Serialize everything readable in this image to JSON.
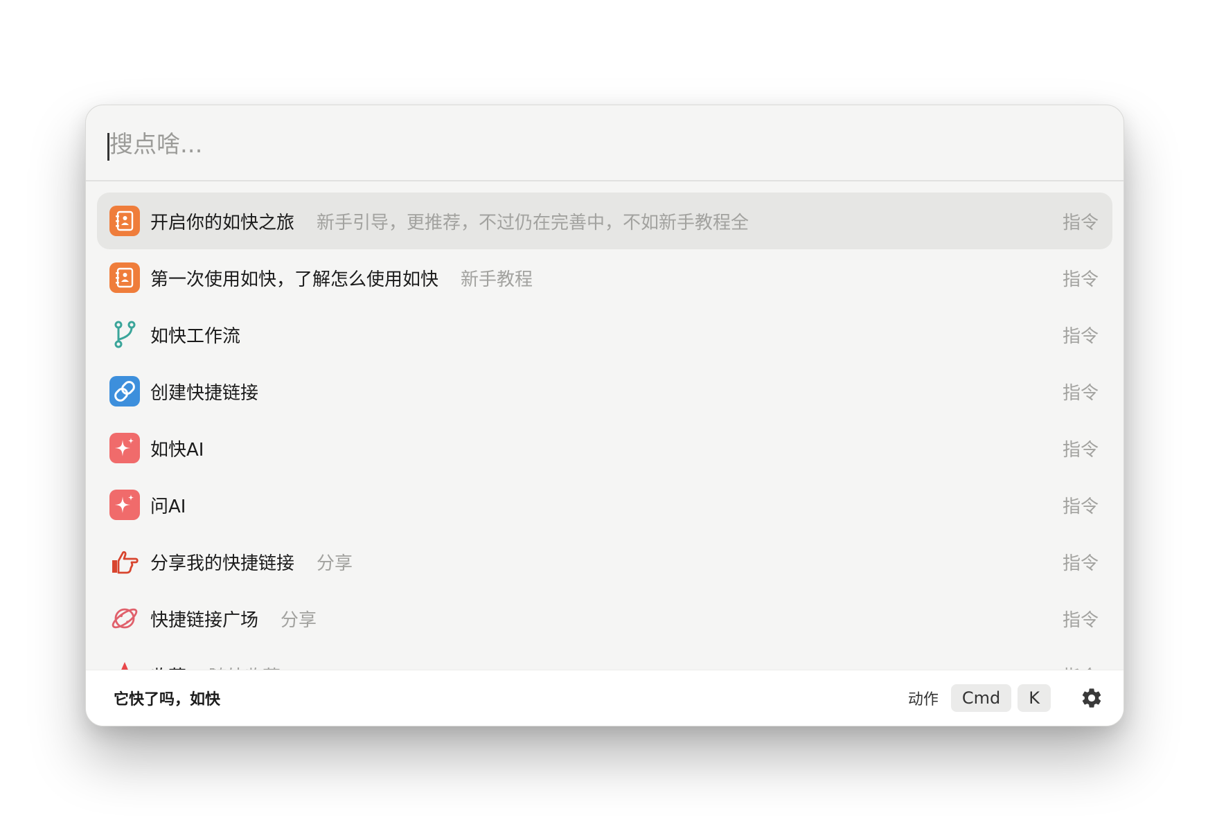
{
  "search": {
    "placeholder": "搜点啥..."
  },
  "results": [
    {
      "title": "开启你的如快之旅",
      "subtitle": "新手引导，更推荐，不过仍在完善中，不如新手教程全",
      "kind": "指令",
      "icon": "notebook-icon",
      "color": "#ef7d3b",
      "selected": true
    },
    {
      "title": "第一次使用如快，了解怎么使用如快",
      "subtitle": "新手教程",
      "kind": "指令",
      "icon": "notebook-icon",
      "color": "#ef7d3b"
    },
    {
      "title": "如快工作流",
      "subtitle": "",
      "kind": "指令",
      "icon": "workflow-branch-icon",
      "color": "#3aa59a"
    },
    {
      "title": "创建快捷链接",
      "subtitle": "",
      "kind": "指令",
      "icon": "link-icon",
      "color": "#3d8fdc"
    },
    {
      "title": "如快AI",
      "subtitle": "",
      "kind": "指令",
      "icon": "ai-sparkle-icon",
      "color": "#f06b6b"
    },
    {
      "title": "问AI",
      "subtitle": "",
      "kind": "指令",
      "icon": "ai-sparkle-icon",
      "color": "#f06b6b"
    },
    {
      "title": "分享我的快捷链接",
      "subtitle": "分享",
      "kind": "指令",
      "icon": "thumbs-up-pointing-icon",
      "color": "#d8452e"
    },
    {
      "title": "快捷链接广场",
      "subtitle": "分享",
      "kind": "指令",
      "icon": "planet-icon",
      "color": "#e0606b"
    },
    {
      "title": "收藏",
      "subtitle": "随处收藏",
      "kind": "指令",
      "icon": "star-icon",
      "color": "#e8474a"
    }
  ],
  "footer": {
    "brand": "它快了吗，如快",
    "action_label": "动作",
    "keys": [
      "Cmd",
      "K"
    ],
    "settings_icon": "gear-icon"
  }
}
